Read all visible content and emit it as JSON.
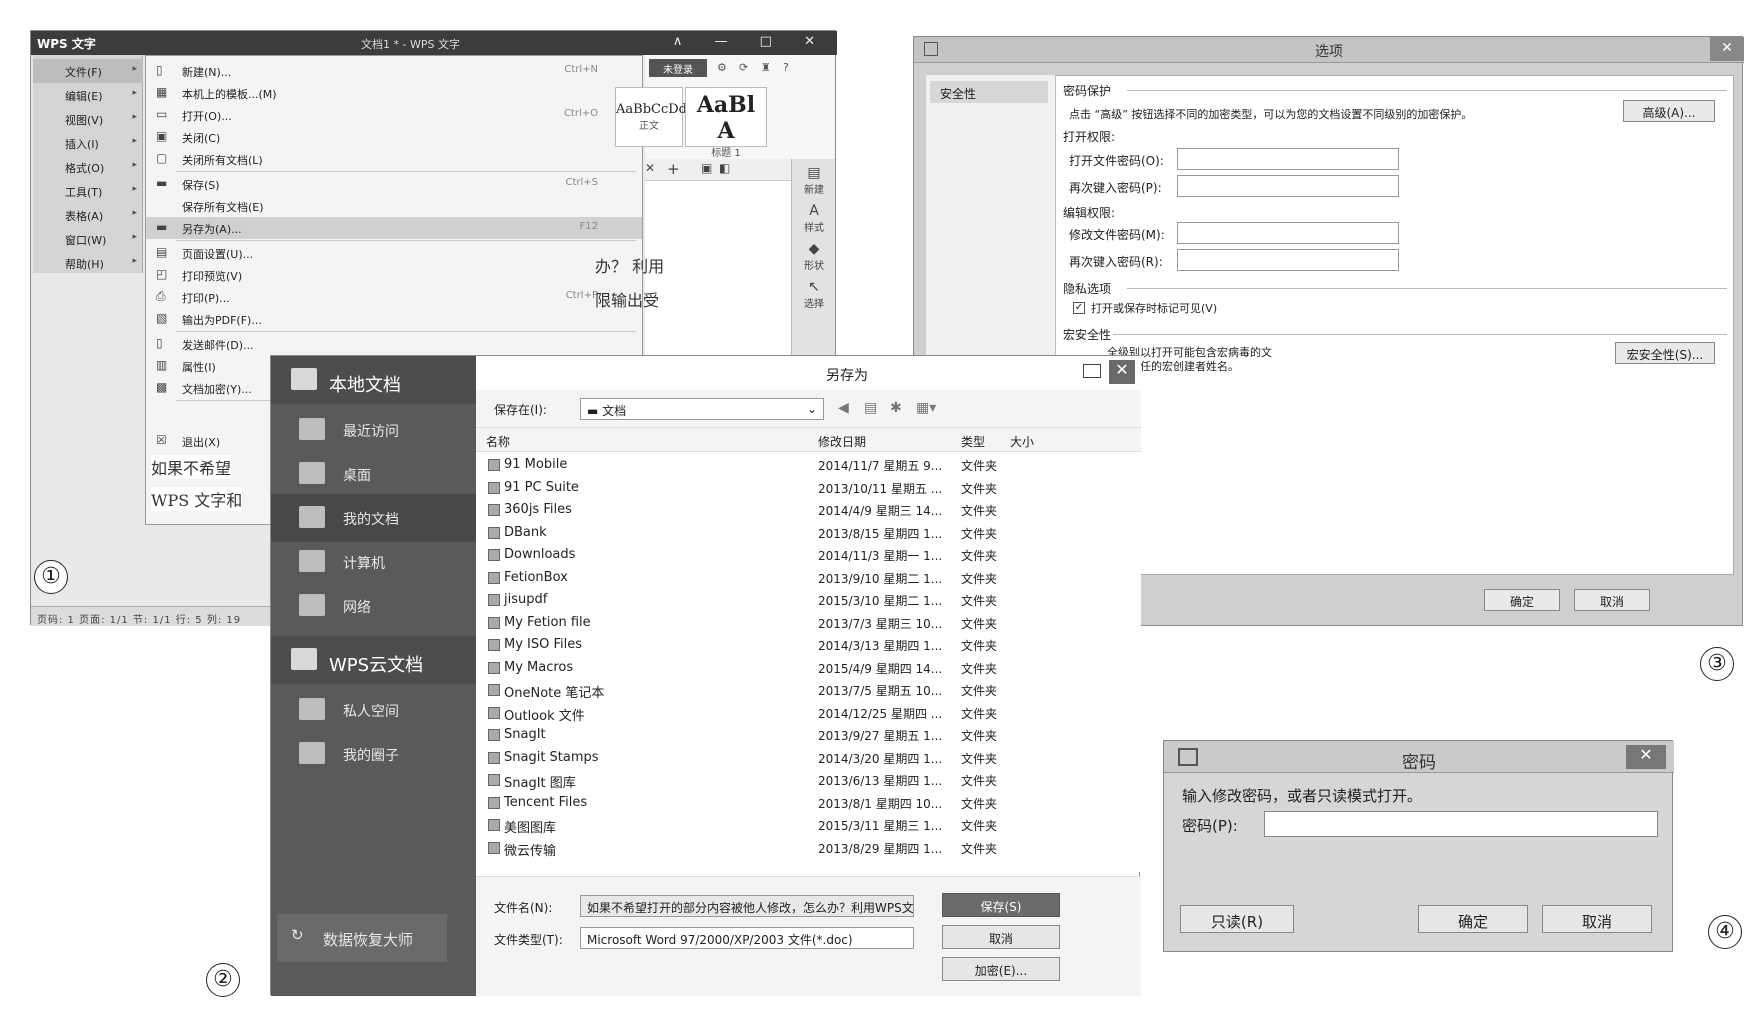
{
  "panel_labels": [
    "①",
    "②",
    "③",
    "④"
  ],
  "wps": {
    "brand": "WPS 文字",
    "doc_title": "文档1 * - WPS 文字",
    "window_controls": "∧ — □ ✕",
    "left_menu": [
      {
        "label": "文件(F)",
        "selected": true
      },
      {
        "label": "编辑(E)"
      },
      {
        "label": "视图(V)"
      },
      {
        "label": "插入(I)"
      },
      {
        "label": "格式(O)"
      },
      {
        "label": "工具(T)"
      },
      {
        "label": "表格(A)"
      },
      {
        "label": "窗口(W)"
      },
      {
        "label": "帮助(H)"
      }
    ],
    "file_menu": [
      {
        "label": "新建(N)...",
        "shortcut": "Ctrl+N",
        "icon": "new-doc-icon"
      },
      {
        "label": "本机上的模板...(M)",
        "shortcut": "",
        "icon": "template-icon"
      },
      {
        "label": "打开(O)...",
        "shortcut": "Ctrl+O",
        "icon": "open-icon"
      },
      {
        "label": "关闭(C)",
        "shortcut": "",
        "icon": "close-doc-icon"
      },
      {
        "label": "关闭所有文档(L)",
        "shortcut": "",
        "icon": "close-all-icon"
      },
      {
        "label": "保存(S)",
        "shortcut": "Ctrl+S",
        "icon": "save-icon"
      },
      {
        "label": "保存所有文档(E)",
        "shortcut": "",
        "icon": ""
      },
      {
        "label": "另存为(A)...",
        "shortcut": "F12",
        "icon": "save-as-icon",
        "selected": true
      },
      {
        "label": "页面设置(U)...",
        "shortcut": "",
        "icon": "page-setup-icon"
      },
      {
        "label": "打印预览(V)",
        "shortcut": "",
        "icon": "print-preview-icon"
      },
      {
        "label": "打印(P)...",
        "shortcut": "Ctrl+P",
        "icon": "print-icon"
      },
      {
        "label": "输出为PDF(F)...",
        "shortcut": "",
        "icon": "pdf-icon"
      },
      {
        "label": "发送邮件(D)...",
        "shortcut": "",
        "icon": "mail-icon"
      },
      {
        "label": "属性(I)",
        "shortcut": "",
        "icon": "properties-icon"
      },
      {
        "label": "文档加密(Y)...",
        "shortcut": "",
        "icon": "encrypt-icon"
      },
      {
        "label": "退出(X)",
        "shortcut": "",
        "icon": "exit-icon"
      }
    ],
    "login": "未登录",
    "styles": [
      {
        "preview": "AaBbCcDd",
        "caption": "正文"
      },
      {
        "preview": "AaBl A",
        "caption": "标题 1"
      }
    ],
    "side_buttons": [
      "新建",
      "样式",
      "形状",
      "选择"
    ],
    "doc_lines": [
      "办？ 利用",
      "限输出受",
      "如果不希望",
      "WPS 文字和"
    ],
    "status": "页码: 1  页面: 1/1  节: 1/1  行: 5  列: 19"
  },
  "options_dialog": {
    "title": "选项",
    "nav_selected": "安全性",
    "section_password": "密码保护",
    "encrypt_hint": "点击 “高级” 按钮选择不同的加密类型，可以为您的文档设置不同级别的加密保护。",
    "advanced_button": "高级(A)...",
    "open_perm": "打开权限:",
    "open_pwd": "打开文件密码(O):",
    "open_pwd_confirm": "再次键入密码(P):",
    "edit_perm": "编辑权限:",
    "edit_pwd": "修改文件密码(M):",
    "edit_pwd_confirm": "再次键入密码(R):",
    "privacy": "隐私选项",
    "privacy_check": "打开或保存时标记可见(V)",
    "macro_section": "宏安全性",
    "macro_text_1": "全级别以打开可能包含宏病毒的文",
    "macro_text_2": "能可靠任的宏创建者姓名。",
    "macro_button": "宏安全性(S)...",
    "ok": "确定",
    "cancel": "取消"
  },
  "save_as": {
    "title": "另存为",
    "nav": [
      {
        "label": "本地文档",
        "head": true
      },
      {
        "label": "最近访问"
      },
      {
        "label": "桌面"
      },
      {
        "label": "我的文档",
        "selected": true
      },
      {
        "label": "计算机"
      },
      {
        "label": "网络"
      },
      {
        "label": "WPS云文档",
        "head": true
      },
      {
        "label": "私人空间"
      },
      {
        "label": "我的圈子"
      }
    ],
    "recovery": "数据恢复大师",
    "save_in_label": "保存在(I):",
    "save_in_value": "文档",
    "columns": {
      "name": "名称",
      "date": "修改日期",
      "type": "类型",
      "size": "大小"
    },
    "files": [
      {
        "name": "91 Mobile",
        "date": "2014/11/7 星期五 9...",
        "type": "文件夹"
      },
      {
        "name": "91 PC Suite",
        "date": "2013/10/11 星期五 ...",
        "type": "文件夹"
      },
      {
        "name": "360js Files",
        "date": "2014/4/9 星期三 14...",
        "type": "文件夹"
      },
      {
        "name": "DBank",
        "date": "2013/8/15 星期四 1...",
        "type": "文件夹"
      },
      {
        "name": "Downloads",
        "date": "2014/11/3 星期一 1...",
        "type": "文件夹"
      },
      {
        "name": "FetionBox",
        "date": "2013/9/10 星期二 1...",
        "type": "文件夹"
      },
      {
        "name": "jisupdf",
        "date": "2015/3/10 星期二 1...",
        "type": "文件夹"
      },
      {
        "name": "My Fetion file",
        "date": "2013/7/3 星期三 10...",
        "type": "文件夹"
      },
      {
        "name": "My ISO Files",
        "date": "2014/3/13 星期四 1...",
        "type": "文件夹"
      },
      {
        "name": "My Macros",
        "date": "2015/4/9 星期四 14...",
        "type": "文件夹"
      },
      {
        "name": "OneNote 笔记本",
        "date": "2013/7/5 星期五 10...",
        "type": "文件夹"
      },
      {
        "name": "Outlook 文件",
        "date": "2014/12/25 星期四 ...",
        "type": "文件夹"
      },
      {
        "name": "SnagIt",
        "date": "2013/9/27 星期五 1...",
        "type": "文件夹"
      },
      {
        "name": "Snagit Stamps",
        "date": "2014/3/20 星期四 1...",
        "type": "文件夹"
      },
      {
        "name": "SnagIt 图库",
        "date": "2013/6/13 星期四 1...",
        "type": "文件夹"
      },
      {
        "name": "Tencent Files",
        "date": "2013/8/1 星期四 10...",
        "type": "文件夹"
      },
      {
        "name": "美图图库",
        "date": "2015/3/11 星期三 1...",
        "type": "文件夹"
      },
      {
        "name": "微云传输",
        "date": "2013/8/29 星期四 1...",
        "type": "文件夹"
      }
    ],
    "filename_label": "文件名(N):",
    "filename_value": "如果不希望打开的部分内容被他人修改，怎么办？利用WPS文字限制编辑",
    "filetype_label": "文件类型(T):",
    "filetype_value": "Microsoft Word 97/2000/XP/2003 文件(*.doc)",
    "save_button": "保存(S)",
    "cancel_button": "取消",
    "encrypt_button": "加密(E)..."
  },
  "password_dialog": {
    "title": "密码",
    "prompt": "输入修改密码，或者只读模式打开。",
    "password_label": "密码(P):",
    "readonly_button": "只读(R)",
    "ok_button": "确定",
    "cancel_button": "取消"
  }
}
